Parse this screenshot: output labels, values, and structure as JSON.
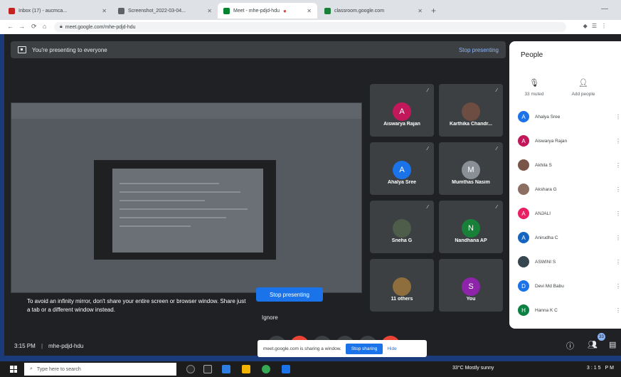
{
  "browser": {
    "tabs": [
      {
        "label": "Inbox (17) - aucmca...",
        "active": false
      },
      {
        "label": "Screenshot_2022-03-04...",
        "active": false
      },
      {
        "label": "Meet - mhe-pdjd-hdu",
        "active": true
      },
      {
        "label": "classroom.google.com",
        "active": false
      }
    ],
    "url": "meet.google.com/mhe-pdjd-hdu"
  },
  "meet": {
    "presenting_banner": "You're presenting to everyone",
    "stop_presenting_link": "Stop presenting",
    "infinity_message": "To avoid an infinity mirror, don't share your entire screen or browser window. Share just a tab or a different window instead.",
    "stop_presenting_button": "Stop presenting",
    "ignore": "Ignore",
    "time": "3:15 PM",
    "separator": "|",
    "meeting_code": "mhe-pdjd-hdu",
    "notification": {
      "text": "meet.google.com is sharing a window.",
      "stop_button": "Stop sharing",
      "hide_button": "Hide"
    },
    "participants_badge": "33",
    "tiles": [
      {
        "name": "Aiswarya Rajan",
        "initial": "A",
        "color": "#c2185b"
      },
      {
        "name": "Karthika Chandr...",
        "initial": "",
        "color": "#6d4c41"
      },
      {
        "name": "Ahalya Sree",
        "initial": "A",
        "color": "#1a73e8"
      },
      {
        "name": "Mumthas Nasim",
        "initial": "M",
        "color": "#8a8f95"
      },
      {
        "name": "Sneha G",
        "initial": "",
        "color": "#4e5d4a"
      },
      {
        "name": "Nandhana AP",
        "initial": "N",
        "color": "#188038"
      },
      {
        "name": "11 others",
        "initial": "",
        "color": "#8d6e3c"
      },
      {
        "name": "You",
        "initial": "S",
        "color": "#8e24aa"
      }
    ]
  },
  "people": {
    "title": "People",
    "actions": [
      {
        "label": "33 muted",
        "icon": "mic-off-icon"
      },
      {
        "label": "Add people",
        "icon": "add-person-icon"
      }
    ],
    "list": [
      {
        "name": "Ahalya Sree",
        "initial": "A",
        "color": "#1a73e8"
      },
      {
        "name": "Aiswarya Rajan",
        "initial": "A",
        "color": "#c2185b"
      },
      {
        "name": "Akhila S",
        "initial": "",
        "color": "#795548"
      },
      {
        "name": "Akshara G",
        "initial": "",
        "color": "#8d6e63"
      },
      {
        "name": "ANJALI",
        "initial": "A",
        "color": "#e91e63"
      },
      {
        "name": "Anirudha C",
        "initial": "A",
        "color": "#1565c0"
      },
      {
        "name": "ASWINI S",
        "initial": "",
        "color": "#37474f"
      },
      {
        "name": "Devi Md Babu",
        "initial": "D",
        "color": "#1a73e8"
      },
      {
        "name": "Hanna K C",
        "initial": "H",
        "color": "#0b8043"
      }
    ]
  },
  "taskbar": {
    "search_placeholder": "Type here to search",
    "weather": "33°C  Mostly sunny",
    "clock": "3:15 PM"
  }
}
